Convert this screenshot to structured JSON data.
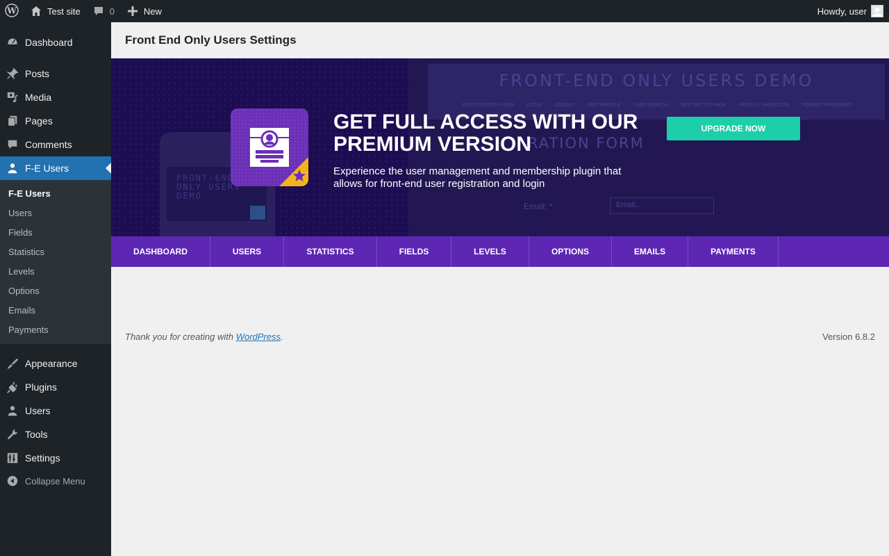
{
  "adminbar": {
    "site_name": "Test site",
    "comments_count": "0",
    "new_label": "New",
    "howdy": "Howdy, user"
  },
  "sidebar": {
    "menu": [
      {
        "label": "Dashboard",
        "icon": "dashboard-icon"
      },
      {
        "label": "Posts",
        "icon": "pin-icon"
      },
      {
        "label": "Media",
        "icon": "media-icon"
      },
      {
        "label": "Pages",
        "icon": "pages-icon"
      },
      {
        "label": "Comments",
        "icon": "comment-icon"
      },
      {
        "label": "F-E Users",
        "icon": "user-icon",
        "active": true
      }
    ],
    "submenu": [
      "F-E Users",
      "Users",
      "Fields",
      "Statistics",
      "Levels",
      "Options",
      "Emails",
      "Payments"
    ],
    "menu_bottom": [
      {
        "label": "Appearance",
        "icon": "brush-icon"
      },
      {
        "label": "Plugins",
        "icon": "plug-icon"
      },
      {
        "label": "Users",
        "icon": "user-icon"
      },
      {
        "label": "Tools",
        "icon": "wrench-icon"
      },
      {
        "label": "Settings",
        "icon": "settings-icon"
      }
    ],
    "collapse_label": "Collapse Menu"
  },
  "page": {
    "title": "Front End Only Users Settings"
  },
  "banner": {
    "heading": "GET FULL ACCESS WITH OUR PREMIUM VERSION",
    "description": "Experience the user management and membership plugin that allows for front-end user registration and login",
    "button_label": "UPGRADE NOW",
    "demo_title": "FRONT-END ONLY USERS DEMO",
    "demo_nav": [
      "REGISTRATION FORM",
      "LOGIN",
      "LOGOUT",
      "EDIT PROFILE",
      "USER SEARCH",
      "RESTRICTED PAGE",
      "PROFILE SHOWCASE",
      "FORGOT PASSWORD"
    ],
    "demo_form_title": "RATION FORM",
    "demo_email_label": "Email: *",
    "demo_email_placeholder": "Email...",
    "phone_text": "FRONT-END ONLY USERS DEMO",
    "accent_color": "#1ccfa8",
    "tab_bar_color": "#5d26b3"
  },
  "tabs": [
    "DASHBOARD",
    "USERS",
    "STATISTICS",
    "FIELDS",
    "LEVELS",
    "OPTIONS",
    "EMAILS",
    "PAYMENTS"
  ],
  "footer": {
    "thanks_prefix": "Thank you for creating with ",
    "thanks_link": "WordPress",
    "thanks_suffix": ".",
    "version": "Version 6.8.2"
  }
}
